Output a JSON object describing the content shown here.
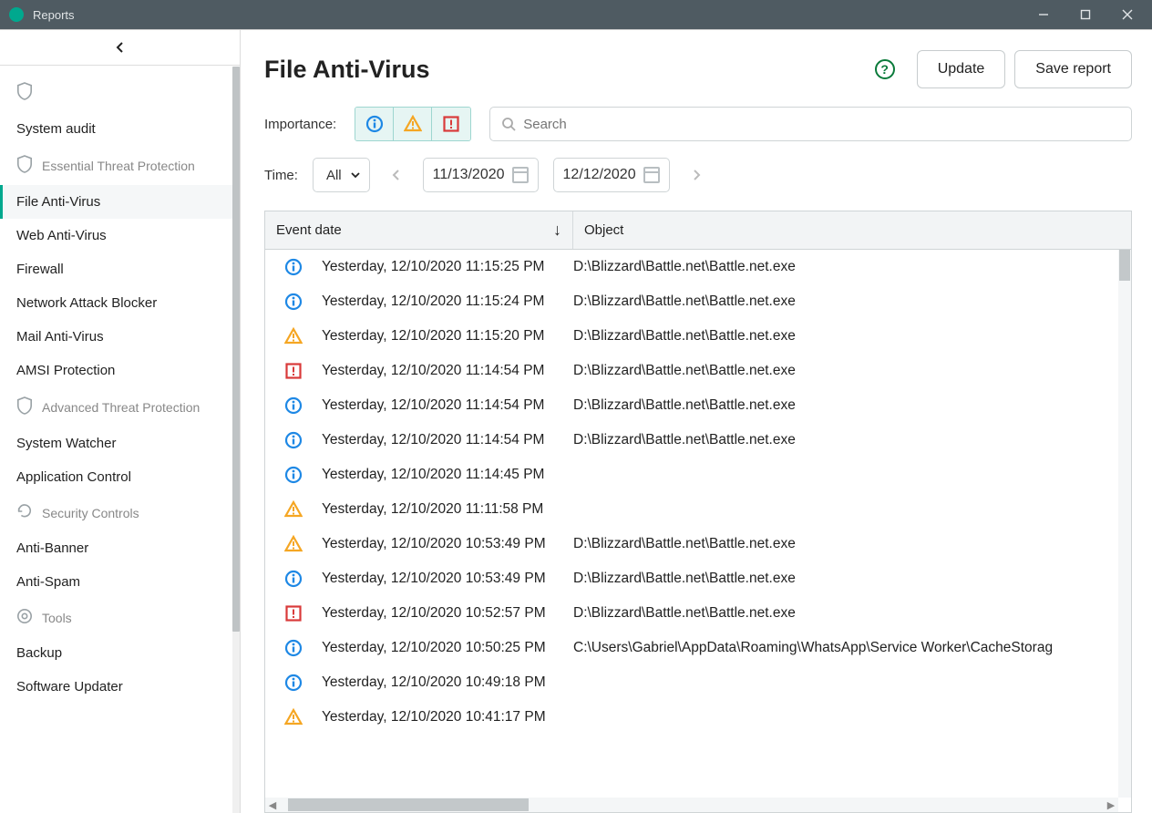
{
  "window": {
    "title": "Reports"
  },
  "sidebar": {
    "sections": [
      {
        "label": "System audit",
        "items": []
      },
      {
        "label": "Essential Threat Protection",
        "items": [
          {
            "label": "File Anti-Virus",
            "active": true
          },
          {
            "label": "Web Anti-Virus"
          },
          {
            "label": "Firewall"
          },
          {
            "label": "Network Attack Blocker"
          },
          {
            "label": "Mail Anti-Virus"
          },
          {
            "label": "AMSI Protection"
          }
        ]
      },
      {
        "label": "Advanced Threat Protection",
        "items": [
          {
            "label": "System Watcher"
          },
          {
            "label": "Application Control"
          }
        ]
      },
      {
        "label": "Security Controls",
        "items": [
          {
            "label": "Anti-Banner"
          },
          {
            "label": "Anti-Spam"
          }
        ]
      },
      {
        "label": "Tools",
        "items": [
          {
            "label": "Backup"
          },
          {
            "label": "Software Updater"
          }
        ]
      }
    ]
  },
  "header": {
    "title": "File Anti-Virus",
    "update_label": "Update",
    "save_label": "Save report"
  },
  "filters": {
    "importance_label": "Importance:",
    "search_placeholder": "Search",
    "time_label": "Time:",
    "time_selected": "All",
    "date_from": "11/13/2020",
    "date_to": "12/12/2020"
  },
  "table": {
    "columns": {
      "date": "Event date",
      "object": "Object"
    },
    "rows": [
      {
        "sev": "info",
        "date": "Yesterday, 12/10/2020 11:15:25 PM",
        "object": "D:\\Blizzard\\Battle.net\\Battle.net.exe"
      },
      {
        "sev": "info",
        "date": "Yesterday, 12/10/2020 11:15:24 PM",
        "object": "D:\\Blizzard\\Battle.net\\Battle.net.exe"
      },
      {
        "sev": "warn",
        "date": "Yesterday, 12/10/2020 11:15:20 PM",
        "object": "D:\\Blizzard\\Battle.net\\Battle.net.exe"
      },
      {
        "sev": "crit",
        "date": "Yesterday, 12/10/2020 11:14:54 PM",
        "object": "D:\\Blizzard\\Battle.net\\Battle.net.exe"
      },
      {
        "sev": "info",
        "date": "Yesterday, 12/10/2020 11:14:54 PM",
        "object": "D:\\Blizzard\\Battle.net\\Battle.net.exe"
      },
      {
        "sev": "info",
        "date": "Yesterday, 12/10/2020 11:14:54 PM",
        "object": "D:\\Blizzard\\Battle.net\\Battle.net.exe"
      },
      {
        "sev": "info",
        "date": "Yesterday, 12/10/2020 11:14:45 PM",
        "object": ""
      },
      {
        "sev": "warn",
        "date": "Yesterday, 12/10/2020 11:11:58 PM",
        "object": ""
      },
      {
        "sev": "warn",
        "date": "Yesterday, 12/10/2020 10:53:49 PM",
        "object": "D:\\Blizzard\\Battle.net\\Battle.net.exe"
      },
      {
        "sev": "info",
        "date": "Yesterday, 12/10/2020 10:53:49 PM",
        "object": "D:\\Blizzard\\Battle.net\\Battle.net.exe"
      },
      {
        "sev": "crit",
        "date": "Yesterday, 12/10/2020 10:52:57 PM",
        "object": "D:\\Blizzard\\Battle.net\\Battle.net.exe"
      },
      {
        "sev": "info",
        "date": "Yesterday, 12/10/2020 10:50:25 PM",
        "object": "C:\\Users\\Gabriel\\AppData\\Roaming\\WhatsApp\\Service Worker\\CacheStorag"
      },
      {
        "sev": "info",
        "date": "Yesterday, 12/10/2020 10:49:18 PM",
        "object": ""
      },
      {
        "sev": "warn",
        "date": "Yesterday, 12/10/2020 10:41:17 PM",
        "object": ""
      }
    ]
  }
}
